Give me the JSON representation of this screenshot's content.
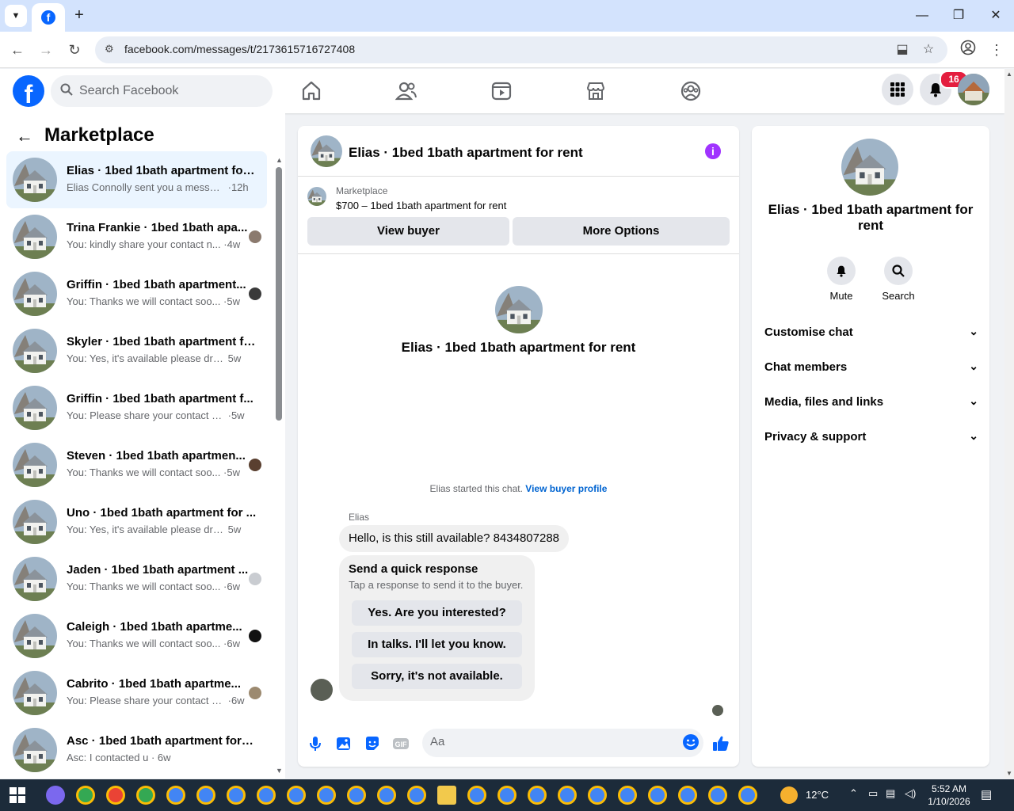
{
  "browser": {
    "url": "facebook.com/messages/t/2173615716727408",
    "new_tab_glyph": "+",
    "tab_icon": "facebook-icon"
  },
  "header": {
    "search_placeholder": "Search Facebook",
    "notification_count": "16"
  },
  "sidebar": {
    "title": "Marketplace",
    "conversations": [
      {
        "title": "Elias · 1bed 1bath apartment for ...",
        "snippet": "Elias Connolly sent you a message...",
        "time": "·12h",
        "active": true,
        "mini": ""
      },
      {
        "title": "Trina Frankie · 1bed 1bath apa...",
        "snippet": "You: kindly share your contact n...",
        "time": "·4w",
        "mini": "#8b7a6e"
      },
      {
        "title": "Griffin · 1bed 1bath apartment...",
        "snippet": "You: Thanks we will contact soo...",
        "time": "·5w",
        "mini": "#3a3a3a"
      },
      {
        "title": "Skyler · 1bed 1bath apartment fo...",
        "snippet": "You: Yes, it's available please drop ...",
        "time": "5w",
        "mini": ""
      },
      {
        "title": "Griffin · 1bed 1bath apartment f...",
        "snippet": "You: Please share your contact nu...",
        "time": "·5w",
        "mini": ""
      },
      {
        "title": "Steven · 1bed 1bath apartmen...",
        "snippet": "You: Thanks we will contact soo...",
        "time": "·5w",
        "mini": "#5a4030"
      },
      {
        "title": "Uno · 1bed 1bath apartment for ...",
        "snippet": "You: Yes, it's available please drop ...",
        "time": "5w",
        "mini": ""
      },
      {
        "title": "Jaden · 1bed 1bath apartment ...",
        "snippet": "You: Thanks we will contact soo...",
        "time": "·6w",
        "mini": "#c9ccd1"
      },
      {
        "title": "Caleigh · 1bed 1bath apartme...",
        "snippet": "You: Thanks we will contact soo...",
        "time": "·6w",
        "mini": "#111111"
      },
      {
        "title": "Cabrito · 1bed 1bath apartme...",
        "snippet": "You: Please share your contact n...",
        "time": "·6w",
        "mini": "#9c8a70"
      },
      {
        "title": "Asc · 1bed 1bath apartment for r...",
        "snippet": "Asc: I contacted u",
        "time": "· 6w",
        "mini": ""
      }
    ]
  },
  "chat": {
    "title": "Elias · 1bed 1bath apartment for rent",
    "marketplace_label": "Marketplace",
    "listing": "$700 – 1bed 1bath apartment for rent",
    "view_buyer": "View buyer",
    "more_options": "More Options",
    "center_title": "Elias · 1bed 1bath apartment for rent",
    "started_text": "Elias started this chat.",
    "view_buyer_profile": "View buyer profile",
    "sender": "Elias",
    "message": "Hello, is this still available? 8434807288",
    "quick_title": "Send a quick response",
    "quick_sub": "Tap a response to send it to the buyer.",
    "quick_responses": [
      "Yes. Are you interested?",
      "In talks. I'll let you know.",
      "Sorry, it's not available."
    ],
    "composer_placeholder": "Aa"
  },
  "info": {
    "title": "Elias · 1bed 1bath apartment for rent",
    "mute": "Mute",
    "search": "Search",
    "sections": [
      "Customise chat",
      "Chat members",
      "Media, files and links",
      "Privacy & support"
    ]
  },
  "taskbar": {
    "temperature": "12°C",
    "time": "5:52 AM",
    "date": "1/10/2026"
  },
  "colors": {
    "brand": "#0866ff",
    "accent_link": "#0064d1",
    "info_purple": "#a033ff",
    "active_row": "#ebf5ff",
    "badge_red": "#e41e3f"
  }
}
